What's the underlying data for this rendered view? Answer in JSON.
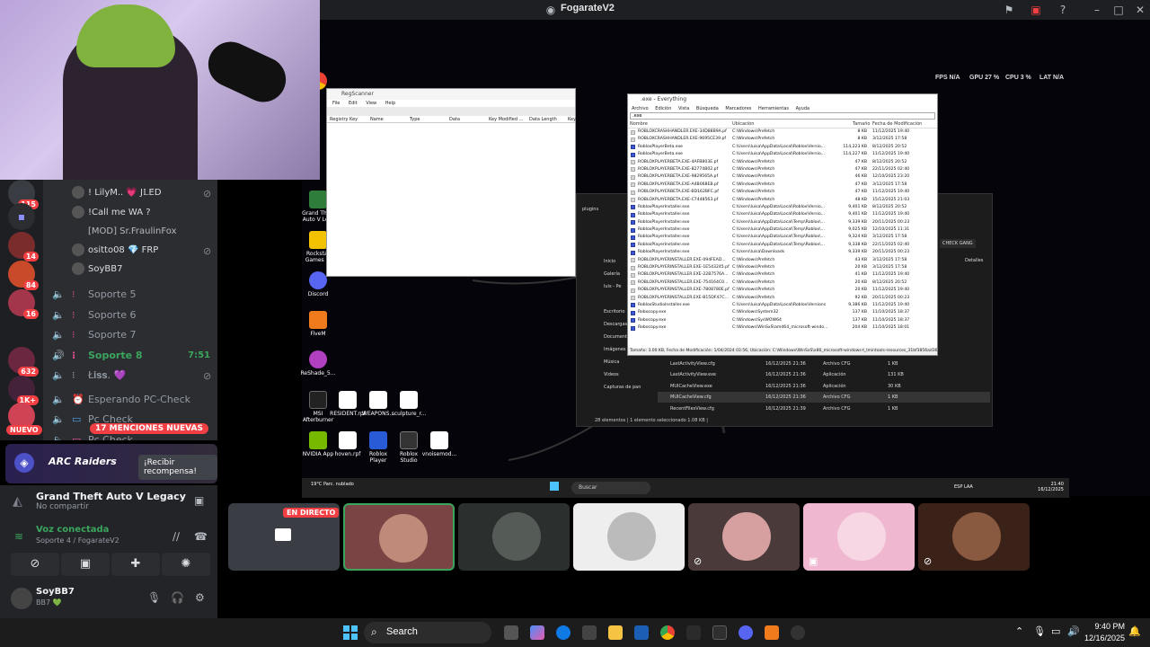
{
  "window": {
    "title": "FogarateV2"
  },
  "stream_hud": {
    "fps": "FPS N/A",
    "gpu": "GPU 27 %",
    "cpu": "CPU 3 %",
    "lat": "LAT N/A"
  },
  "desktop_icons": [
    {
      "label": "Grand Theft Auto V Le...",
      "color": "#2f7d3a"
    },
    {
      "label": "Rockstar Games ...",
      "color": "#f2c200"
    },
    {
      "label": "Discord",
      "color": "#5865f2"
    },
    {
      "label": "FiveM",
      "color": "#f07b1d"
    },
    {
      "label": "ReShade_5...",
      "color": "#b040c0"
    },
    {
      "label": "MSI Afterburner",
      "color": "#222222"
    },
    {
      "label": "RESIDENT.rpf",
      "color": "#ffffff"
    },
    {
      "label": "WEAPONS...",
      "color": "#ffffff"
    },
    {
      "label": "sculpture_r...",
      "color": "#ffffff"
    },
    {
      "label": "NVIDIA App",
      "color": "#76b900"
    },
    {
      "label": "hoven.rpf",
      "color": "#ffffff"
    },
    {
      "label": "Roblox Player",
      "color": "#2a5bd7"
    },
    {
      "label": "Roblox Studio",
      "color": "#333333"
    },
    {
      "label": "vnoisemod...",
      "color": "#ffffff"
    }
  ],
  "regedit": {
    "title": "RegScanner",
    "menu": [
      "File",
      "Edit",
      "View",
      "Help"
    ],
    "columns": [
      "Registry Key",
      "Name",
      "Type",
      "Data",
      "Key Modified ...",
      "Data Length",
      "Key"
    ]
  },
  "everything": {
    "title": ".exe - Everything",
    "menu": [
      "Archivo",
      "Edición",
      "Vista",
      "Búsqueda",
      "Marcadores",
      "Herramientas",
      "Ayuda"
    ],
    "search": ".exe",
    "columns": [
      "Nombre",
      "Ubicación",
      "Tamaño",
      "Fecha de Modificación"
    ],
    "rows": [
      {
        "name": "ROBLOXCRASHHANDLER.EXE-34D88B9A.pf",
        "path": "C:\\Windows\\Prefetch",
        "size": "8 KB",
        "date": "11/12/2025 19:40",
        "exe": false
      },
      {
        "name": "ROBLOXCRASHHANDLER.EXE-9695CE39.pf",
        "path": "C:\\Windows\\Prefetch",
        "size": "8 KB",
        "date": "3/12/2025 17:58",
        "exe": false
      },
      {
        "name": "RobloxPlayerBeta.exe",
        "path": "C:\\Users\\luisa\\AppData\\Local\\Roblox\\Versio...",
        "size": "114,223 KB",
        "date": "8/12/2025 20:52",
        "exe": true
      },
      {
        "name": "RobloxPlayerBeta.exe",
        "path": "C:\\Users\\luisa\\AppData\\Local\\Roblox\\Versio...",
        "size": "114,227 KB",
        "date": "11/12/2025 19:40",
        "exe": true
      },
      {
        "name": "ROBLOXPLAYERBETA.EXE-4AFB803E.pf",
        "path": "C:\\Windows\\Prefetch",
        "size": "47 KB",
        "date": "8/12/2025 20:52",
        "exe": false
      },
      {
        "name": "ROBLOXPLAYERBETA.EXE-82774B02.pf",
        "path": "C:\\Windows\\Prefetch",
        "size": "47 KB",
        "date": "22/11/2025 02:40",
        "exe": false
      },
      {
        "name": "ROBLOXPLAYERBETA.EXE-9829565A.pf",
        "path": "C:\\Windows\\Prefetch",
        "size": "46 KB",
        "date": "12/10/2025 23:20",
        "exe": false
      },
      {
        "name": "ROBLOXPLAYERBETA.EXE-A4B068EB.pf",
        "path": "C:\\Windows\\Prefetch",
        "size": "47 KB",
        "date": "3/12/2025 17:58",
        "exe": false
      },
      {
        "name": "ROBLOXPLAYERBETA.EXE-BD162BFC.pf",
        "path": "C:\\Windows\\Prefetch",
        "size": "47 KB",
        "date": "11/12/2025 19:40",
        "exe": false
      },
      {
        "name": "ROBLOXPLAYERBETA.EXE-C7448563.pf",
        "path": "C:\\Windows\\Prefetch",
        "size": "48 KB",
        "date": "15/12/2025 21:03",
        "exe": false
      },
      {
        "name": "RobloxPlayerInstaller.exe",
        "path": "C:\\Users\\luisa\\AppData\\Local\\Roblox\\Versio...",
        "size": "9,401 KB",
        "date": "8/12/2025 20:52",
        "exe": true
      },
      {
        "name": "RobloxPlayerInstaller.exe",
        "path": "C:\\Users\\luisa\\AppData\\Local\\Roblox\\Versio...",
        "size": "9,401 KB",
        "date": "11/12/2025 19:40",
        "exe": true
      },
      {
        "name": "RobloxPlayerInstaller.exe",
        "path": "C:\\Users\\luisa\\AppData\\Local\\Temp\\Roblox\\...",
        "size": "9,339 KB",
        "date": "20/11/2025 00:23",
        "exe": true
      },
      {
        "name": "RobloxPlayerInstaller.exe",
        "path": "C:\\Users\\luisa\\AppData\\Local\\Temp\\Roblox\\...",
        "size": "9,025 KB",
        "date": "12/10/2025 11:31",
        "exe": true
      },
      {
        "name": "RobloxPlayerInstaller.exe",
        "path": "C:\\Users\\luisa\\AppData\\Local\\Temp\\Roblox\\...",
        "size": "9,324 KB",
        "date": "3/12/2025 17:58",
        "exe": true
      },
      {
        "name": "RobloxPlayerInstaller.exe",
        "path": "C:\\Users\\luisa\\AppData\\Local\\Temp\\Roblox\\...",
        "size": "9,338 KB",
        "date": "22/11/2025 02:40",
        "exe": true
      },
      {
        "name": "RobloxPlayerInstaller.exe",
        "path": "C:\\Users\\luisa\\Downloads",
        "size": "9,339 KB",
        "date": "20/11/2025 00:23",
        "exe": true
      },
      {
        "name": "ROBLOXPLAYERINSTALLER.EXE-094FEAD...",
        "path": "C:\\Windows\\Prefetch",
        "size": "43 KB",
        "date": "3/12/2025 17:58",
        "exe": false
      },
      {
        "name": "ROBLOXPLAYERINSTALLER.EXE-1E543245.pf",
        "path": "C:\\Windows\\Prefetch",
        "size": "20 KB",
        "date": "3/12/2025 17:58",
        "exe": false
      },
      {
        "name": "ROBLOXPLAYERINSTALLER.EXE-22B7576A...",
        "path": "C:\\Windows\\Prefetch",
        "size": "41 KB",
        "date": "11/12/2025 19:40",
        "exe": false
      },
      {
        "name": "ROBLOXPLAYERINSTALLER.EXE-754164C0...",
        "path": "C:\\Windows\\Prefetch",
        "size": "20 KB",
        "date": "8/12/2025 20:52",
        "exe": false
      },
      {
        "name": "ROBLOXPLAYERINSTALLER.EXE-7808780E.pf",
        "path": "C:\\Windows\\Prefetch",
        "size": "20 KB",
        "date": "11/12/2025 19:40",
        "exe": false
      },
      {
        "name": "ROBLOXPLAYERINSTALLER.EXE-B15DF47C...",
        "path": "C:\\Windows\\Prefetch",
        "size": "92 KB",
        "date": "20/11/2025 00:23",
        "exe": false
      },
      {
        "name": "RobloxStudioInstaller.exe",
        "path": "C:\\Users\\luisa\\AppData\\Local\\Roblox\\Versions",
        "size": "9,386 KB",
        "date": "11/12/2025 19:40",
        "exe": true
      },
      {
        "name": "Robocopy.exe",
        "path": "C:\\Windows\\System32",
        "size": "137 KB",
        "date": "11/10/2025 18:37",
        "exe": true
      },
      {
        "name": "Robocopy.exe",
        "path": "C:\\Windows\\SysWOW64",
        "size": "137 KB",
        "date": "11/10/2025 18:37",
        "exe": true
      },
      {
        "name": "Robocopy.exe",
        "path": "C:\\Windows\\WinSxS\\amd64_microsoft-windo...",
        "size": "204 KB",
        "date": "11/10/2025 18:01",
        "exe": true
      }
    ],
    "footer": "Tamaño: 3.00 KB, Fecha de Modificación: 1/04/2024 03:56, Ubicación: C:\\Windows\\WinSxS\\x86_microsoft-windows-t_lmintools-resources_31bf3856ad364e35"
  },
  "explorer": {
    "title": "plugins",
    "search_hint": "CHECK GANG",
    "details_label": "Detalles",
    "nav": [
      "Inicio",
      "Galería",
      "luis - Pe",
      "Escritorio",
      "Descargas",
      "Documentos",
      "Imágenes",
      "Música",
      "Videos",
      "Capturas de pan"
    ],
    "files": [
      {
        "name": "LastActivityView.cfg",
        "date": "16/12/2025 21:36",
        "type": "Archivo CFG",
        "size": "1 KB"
      },
      {
        "name": "LastActivityView.exe",
        "date": "16/12/2025 21:36",
        "type": "Aplicación",
        "size": "131 KB"
      },
      {
        "name": "MUICacheView.cfg",
        "date": "16/12/2025 21:36",
        "type": "Archivo CFG",
        "size": "1 KB"
      },
      {
        "name": "MUICacheView.exe",
        "date": "16/12/2025 21:36",
        "type": "Aplicación",
        "size": "30 KB"
      },
      {
        "name": "RecentFilesView.cfg",
        "date": "16/12/2025 21:39",
        "type": "Archivo CFG",
        "size": "1 KB"
      }
    ],
    "status": "28 elementos | 1 elemento seleccionado 1.08 KB |"
  },
  "stream_taskbar": {
    "weather": "19°C Parc. nublado",
    "search": "Buscar",
    "time": "21:40",
    "date": "16/12/2025",
    "lang": "ESP LAA"
  },
  "sidebar": {
    "users_top": [
      {
        "name": "! LilyM.. 💗 J𝕃ED"
      },
      {
        "name": "!Call me WA ?"
      },
      {
        "name": "[MOD] Sr.FraulinFox"
      },
      {
        "name": "ositto08 💎 FRP"
      },
      {
        "name": "SoyBB7"
      }
    ],
    "voice_channels": [
      {
        "name": "Soporte 5",
        "time": ""
      },
      {
        "name": "Soporte 6",
        "time": ""
      },
      {
        "name": "Soporte 7",
        "time": ""
      },
      {
        "name": "Soporte 8",
        "time": "7:51"
      },
      {
        "name": "Ł𝐢𝐬𝐬. 💜",
        "time": ""
      },
      {
        "name": "Esperando PC-Check",
        "time": ""
      },
      {
        "name": "Pc Check",
        "time": ""
      },
      {
        "name": "Pc Check",
        "time": ""
      }
    ],
    "server_badges": [
      "115",
      "14",
      "84",
      "16",
      "632",
      "1K+"
    ],
    "mentions": "17 MENCIONES NUEVAS",
    "nuevo": "NUEVO"
  },
  "promo": {
    "brand": "ARC Raiders",
    "button": "¡Recibir recompensa!"
  },
  "activity": {
    "game": "Grand Theft Auto V Legacy",
    "sub": "No compartir"
  },
  "voice": {
    "status": "Voz conectada",
    "channel": "Soporte 4 / FogarateV2"
  },
  "me": {
    "name": "SoyBB7",
    "status": "BB7 💚"
  },
  "tiles": {
    "live_label": "EN DIRECTO"
  },
  "taskbar": {
    "search": "Search",
    "time": "9:40 PM",
    "date": "12/16/2025"
  },
  "colors": {
    "discord_bg": "#2b2d31",
    "accent": "#5865f2",
    "danger": "#f23f43",
    "voice_green": "#3ba55d"
  }
}
